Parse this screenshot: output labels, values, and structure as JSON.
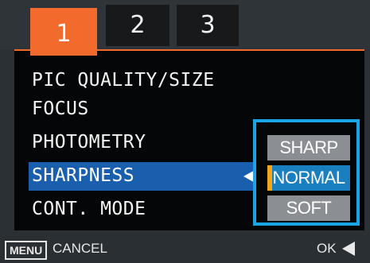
{
  "tabs": [
    {
      "label": "1",
      "active": true
    },
    {
      "label": "2",
      "active": false
    },
    {
      "label": "3",
      "active": false
    }
  ],
  "menu": {
    "items": [
      {
        "label": "PIC QUALITY/SIZE"
      },
      {
        "label": "FOCUS"
      },
      {
        "label": "PHOTOMETRY"
      },
      {
        "label": "SHARPNESS",
        "selected": true
      },
      {
        "label": "CONT. MODE"
      }
    ]
  },
  "sharpness_options": {
    "items": [
      {
        "label": "SHARP"
      },
      {
        "label": "NORMAL",
        "selected": true
      },
      {
        "label": "SOFT"
      }
    ]
  },
  "footer": {
    "menu_key": "MENU",
    "cancel": "CANCEL",
    "ok": "OK"
  },
  "colors": {
    "active_tab": "#f26b2d",
    "highlight": "#1a5fae",
    "options_frame": "#1aa6e6",
    "selected_option": "#1a7fbf",
    "marker": "#f2a51d"
  }
}
